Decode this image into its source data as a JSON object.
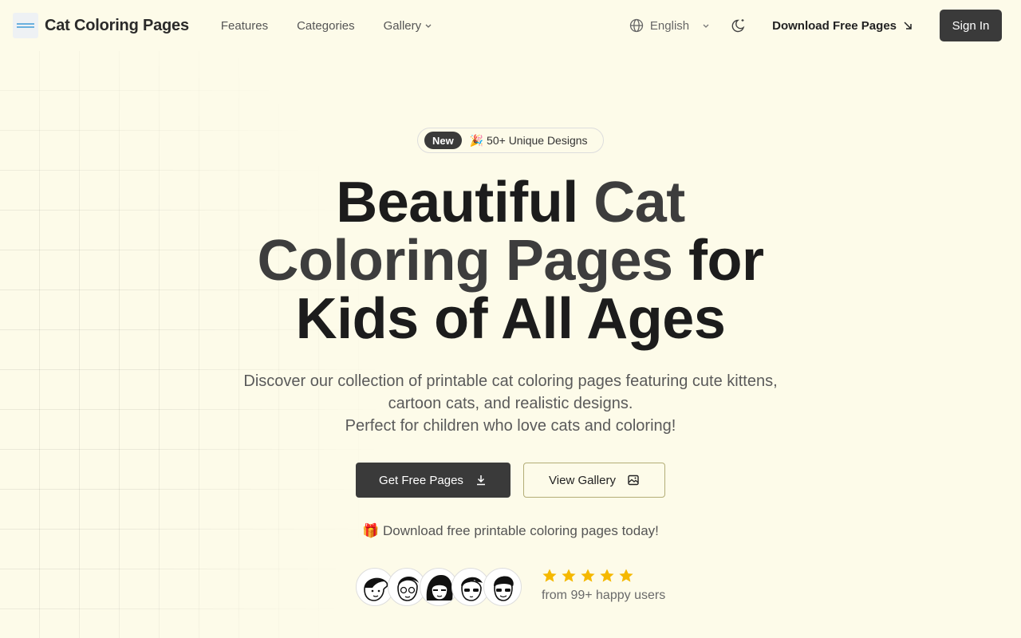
{
  "header": {
    "logo_text": "Cat Coloring Pages",
    "nav": [
      {
        "label": "Features"
      },
      {
        "label": "Categories"
      },
      {
        "label": "Gallery"
      }
    ],
    "language": "English",
    "download_label": "Download Free Pages",
    "signin_label": "Sign In"
  },
  "hero": {
    "badge_new": "New",
    "badge_text": "🎉 50+ Unique Designs",
    "headline": {
      "part1": "Beautiful ",
      "accent1": "Cat",
      "accent2": "Coloring Pages",
      "part2": " for",
      "part3": "Kids of All Ages"
    },
    "subtitle_line1": "Discover our collection of printable cat coloring pages featuring cute kittens,",
    "subtitle_line2": "cartoon cats, and realistic designs.",
    "subtitle_line3": "Perfect for children who love cats and coloring!",
    "primary_button": "Get Free Pages",
    "secondary_button": "View Gallery",
    "promo": "🎁 Download free printable coloring pages today!",
    "rating_text": "from 99+ happy users",
    "stars": 5
  },
  "colors": {
    "background": "#fdfbe9",
    "primary": "#3a3a3a",
    "star": "#f5b800",
    "outline": "#b3ad76"
  },
  "icons": [
    "globe-icon",
    "chevron-down-icon",
    "moon-icon",
    "arrow-down-right-icon",
    "download-icon",
    "gallery-icon",
    "star-icon"
  ]
}
